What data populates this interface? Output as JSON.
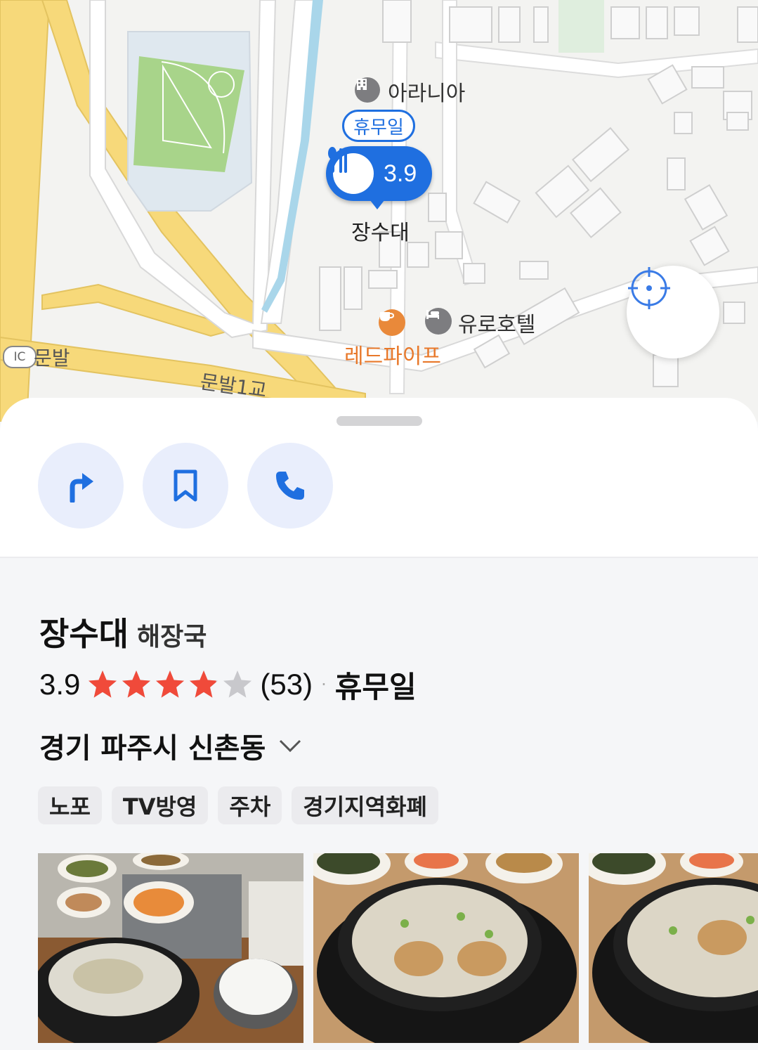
{
  "map": {
    "poi_arania": "아라니아",
    "poi_eurohotel": "유로호텔",
    "poi_redpipe": "레드파이프",
    "road_ic": "IC",
    "road_munbal": "문발",
    "road_munbal_bridge": "문발1교",
    "marker": {
      "status": "휴무일",
      "rating": "3.9",
      "name": "장수대",
      "icon": "restaurant-icon"
    },
    "locate_icon": "locate-crosshair-icon"
  },
  "sheet": {
    "actions": [
      {
        "icon": "directions-arrow-icon"
      },
      {
        "icon": "bookmark-icon"
      },
      {
        "icon": "phone-icon"
      }
    ],
    "place": {
      "name": "장수대",
      "category": "해장국",
      "rating": "3.9",
      "rating_stars": 3.9,
      "review_count": "(53)",
      "separator": "·",
      "status": "휴무일",
      "address": "경기 파주시 신촌동",
      "tags": [
        "노포",
        "TV방영",
        "주차",
        "경기지역화폐"
      ]
    },
    "colors": {
      "accent": "#1f6fe0",
      "star": "#f04a3a",
      "star_empty": "#c8c8cc"
    }
  }
}
